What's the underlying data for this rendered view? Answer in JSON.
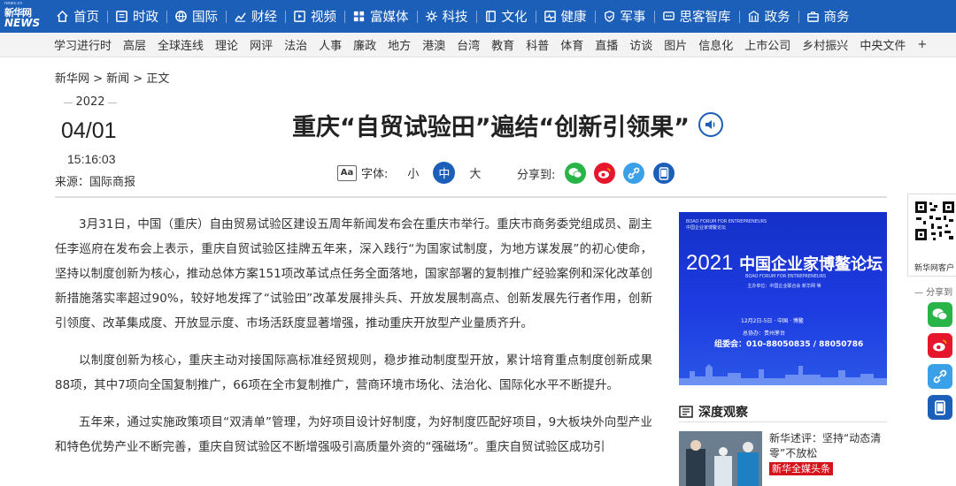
{
  "logo": {
    "small": "news.cn",
    "line1": "新华网",
    "line2": "NEWS"
  },
  "topnav": [
    {
      "label": "首页",
      "icon": "home-icon"
    },
    {
      "label": "时政",
      "icon": "monitor-icon"
    },
    {
      "label": "国际",
      "icon": "globe-icon"
    },
    {
      "label": "财经",
      "icon": "chart-icon"
    },
    {
      "label": "视频",
      "icon": "play-icon"
    },
    {
      "label": "富媒体",
      "icon": "grid-icon"
    },
    {
      "label": "科技",
      "icon": "gear-icon"
    },
    {
      "label": "文化",
      "icon": "book-icon"
    },
    {
      "label": "健康",
      "icon": "heart-pulse-icon"
    },
    {
      "label": "军事",
      "icon": "shield-icon"
    },
    {
      "label": "思客智库",
      "icon": "chat-icon"
    },
    {
      "label": "政务",
      "icon": "building-icon"
    },
    {
      "label": "商务",
      "icon": "briefcase-icon"
    }
  ],
  "subnav": [
    "学习进行时",
    "高层",
    "全球连线",
    "理论",
    "网评",
    "法治",
    "人事",
    "廉政",
    "地方",
    "港澳",
    "台湾",
    "教育",
    "科普",
    "体育",
    "直播",
    "访谈",
    "图片",
    "信息化",
    "上市公司",
    "乡村振兴",
    "中央文件",
    "+"
  ],
  "breadcrumb": "新华网 > 新闻 > 正文",
  "date": {
    "year": "2022",
    "month_day": "04/01",
    "time": "15:16:03",
    "source": "来源：国际商报"
  },
  "article": {
    "title": "重庆“自贸试验田”遍结“创新引领果”",
    "font_label": "字体:",
    "font_icon_text": "Aa",
    "font_sizes": [
      "小",
      "中",
      "大"
    ],
    "share_label": "分享到:",
    "paragraphs": [
      "3月31日，中国（重庆）自由贸易试验区建设五周年新闻发布会在重庆市举行。重庆市商务委党组成员、副主任李巡府在发布会上表示，重庆自贸试验区挂牌五年来，深入践行“为国家试制度，为地方谋发展”的初心使命，坚持以制度创新为核心，推动总体方案151项改革试点任务全面落地，国家部署的复制推广经验案例和深化改革创新措施落实率超过90%，较好地发挥了“试验田”改革发展排头兵、开放发展制高点、创新发展先行者作用，创新引领度、改革集成度、开放显示度、市场活跃度显著增强，推动重庆开放型产业量质齐升。",
      "以制度创新为核心，重庆主动对接国际高标准经贸规则，稳步推动制度型开放，累计培育重点制度创新成果88项，其中7项向全国复制推广，66项在全市复制推广，营商环境市场化、法治化、国际化水平不断提升。",
      "五年来，通过实施政策项目“双清单”管理，为好项目设计好制度，为好制度匹配好项目，9大板块外向型产业和特色优势产业不断完善，重庆自贸试验区不断增强吸引高质量外资的“强磁场”。重庆自贸试验区成功引"
    ]
  },
  "ad": {
    "org_en": "BOAO FORUM FOR ENTREPRENEURS",
    "org_cn": "中国企业家博鳌论坛",
    "year": "2021",
    "name_cn": "中国企业家博鳌论坛",
    "name_en": "BOAO FORUM FOR ENTREPRENEURS",
    "organizers": "主办单位：中国企业联合会 新华网 等",
    "dates": "12月2日-5日 · 中国 · 博鳌",
    "sponsor": "总协办：贵州茅台",
    "phone": "组委会：010-88050835 / 88050786"
  },
  "deep": {
    "heading": "深度观察",
    "news_title": "新华述评：坚持“动态清零”不放松",
    "news_tag": "新华全媒头条"
  },
  "side": {
    "qr_label": "新华网客户",
    "share_label": "分享到"
  },
  "colors": {
    "brand_blue": "#1b5fb8",
    "wechat_green": "#28b446",
    "weibo_red": "#e6162d",
    "link_blue": "#3aa0e8",
    "mobile_blue": "#1b5fb8"
  }
}
